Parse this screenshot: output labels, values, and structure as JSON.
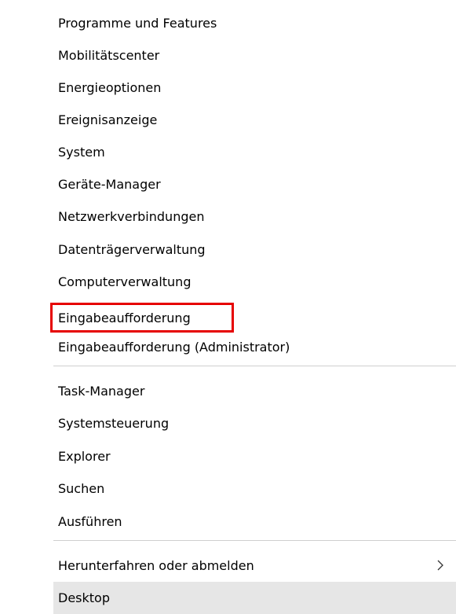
{
  "menu": {
    "items": [
      {
        "label": "Programme und Features"
      },
      {
        "label": "Mobilitätscenter"
      },
      {
        "label": "Energieoptionen"
      },
      {
        "label": "Ereignisanzeige"
      },
      {
        "label": "System"
      },
      {
        "label": "Geräte-Manager"
      },
      {
        "label": "Netzwerkverbindungen"
      },
      {
        "label": "Datenträgerverwaltung"
      },
      {
        "label": "Computerverwaltung"
      },
      {
        "label": "Eingabeaufforderung"
      },
      {
        "label": "Eingabeaufforderung (Administrator)"
      },
      {
        "label": "Task-Manager"
      },
      {
        "label": "Systemsteuerung"
      },
      {
        "label": "Explorer"
      },
      {
        "label": "Suchen"
      },
      {
        "label": "Ausführen"
      },
      {
        "label": "Herunterfahren oder abmelden",
        "submenu_icon": "chevron-right-icon"
      },
      {
        "label": "Desktop",
        "state": "hover-highlighted"
      }
    ]
  },
  "annotation": {
    "highlight_color": "#e60000",
    "highlighted_item": "Eingabeaufforderung"
  }
}
